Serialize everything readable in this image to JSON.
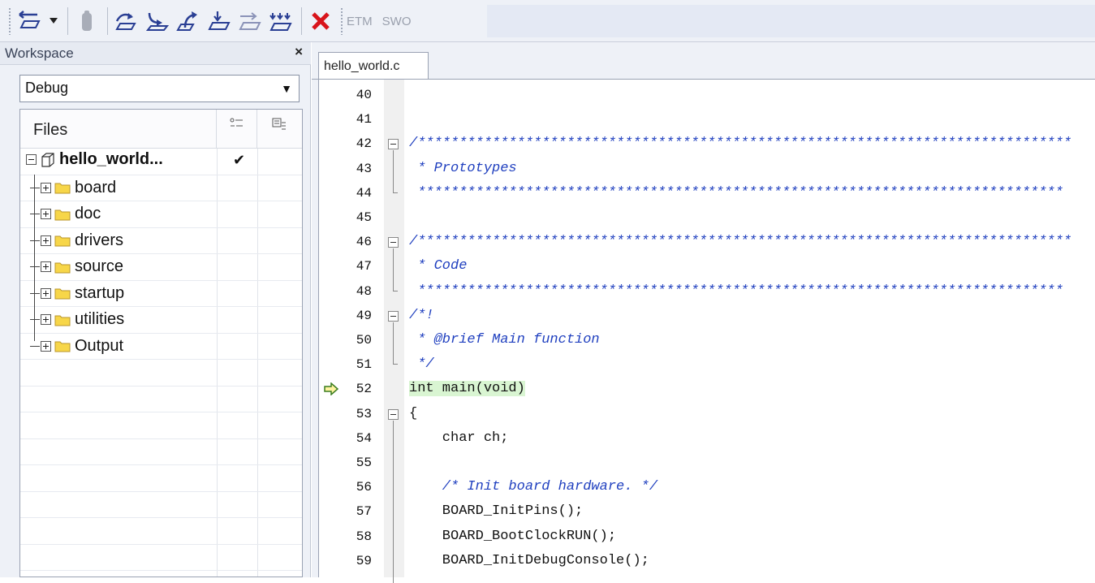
{
  "toolbar": {
    "buttons": [
      "reset-dropdown-icon",
      "break-icon",
      "step-over-icon",
      "step-into-icon",
      "step-out-icon",
      "next-statement-icon",
      "run-to-cursor-icon",
      "go-icon",
      "stop-debugging-icon"
    ],
    "etm_label": "ETM",
    "swo_label": "SWO",
    "stop_color": "#d8141b"
  },
  "workspace": {
    "title": "Workspace",
    "close_label": "×",
    "configuration": "Debug",
    "files_header": "Files",
    "project": {
      "name": "hello_world...",
      "checked": "✔"
    },
    "groups": [
      {
        "label": "board"
      },
      {
        "label": "doc"
      },
      {
        "label": "drivers"
      },
      {
        "label": "source"
      },
      {
        "label": "startup"
      },
      {
        "label": "utilities"
      },
      {
        "label": "Output"
      }
    ],
    "folder_color": "#f7d649"
  },
  "editor": {
    "tab_label": "hello_world.c",
    "current_line": "52",
    "lines": [
      {
        "num": "40",
        "text": "",
        "kind": "code"
      },
      {
        "num": "41",
        "text": "",
        "kind": "code"
      },
      {
        "num": "42",
        "text": "/*******************************************************************************",
        "kind": "comment"
      },
      {
        "num": "43",
        "text": " * Prototypes",
        "kind": "comment"
      },
      {
        "num": "44",
        "text": " ******************************************************************************",
        "kind": "comment"
      },
      {
        "num": "45",
        "text": "",
        "kind": "code"
      },
      {
        "num": "46",
        "text": "/*******************************************************************************",
        "kind": "comment"
      },
      {
        "num": "47",
        "text": " * Code",
        "kind": "comment"
      },
      {
        "num": "48",
        "text": " ******************************************************************************",
        "kind": "comment"
      },
      {
        "num": "49",
        "text": "/*!",
        "kind": "comment"
      },
      {
        "num": "50",
        "text": " * @brief Main function",
        "kind": "comment"
      },
      {
        "num": "51",
        "text": " */",
        "kind": "comment"
      },
      {
        "num": "52",
        "text": "int main(void)",
        "kind": "code"
      },
      {
        "num": "53",
        "text": "{",
        "kind": "code"
      },
      {
        "num": "54",
        "text": "    char ch;",
        "kind": "code"
      },
      {
        "num": "55",
        "text": "",
        "kind": "code"
      },
      {
        "num": "56",
        "text": "    /* Init board hardware. */",
        "kind": "comment"
      },
      {
        "num": "57",
        "text": "    BOARD_InitPins();",
        "kind": "code"
      },
      {
        "num": "58",
        "text": "    BOARD_BootClockRUN();",
        "kind": "code"
      },
      {
        "num": "59",
        "text": "    BOARD_InitDebugConsole();",
        "kind": "code"
      }
    ],
    "comment_color": "#1f3fbf",
    "highlight_color": "#d9f5d2"
  }
}
